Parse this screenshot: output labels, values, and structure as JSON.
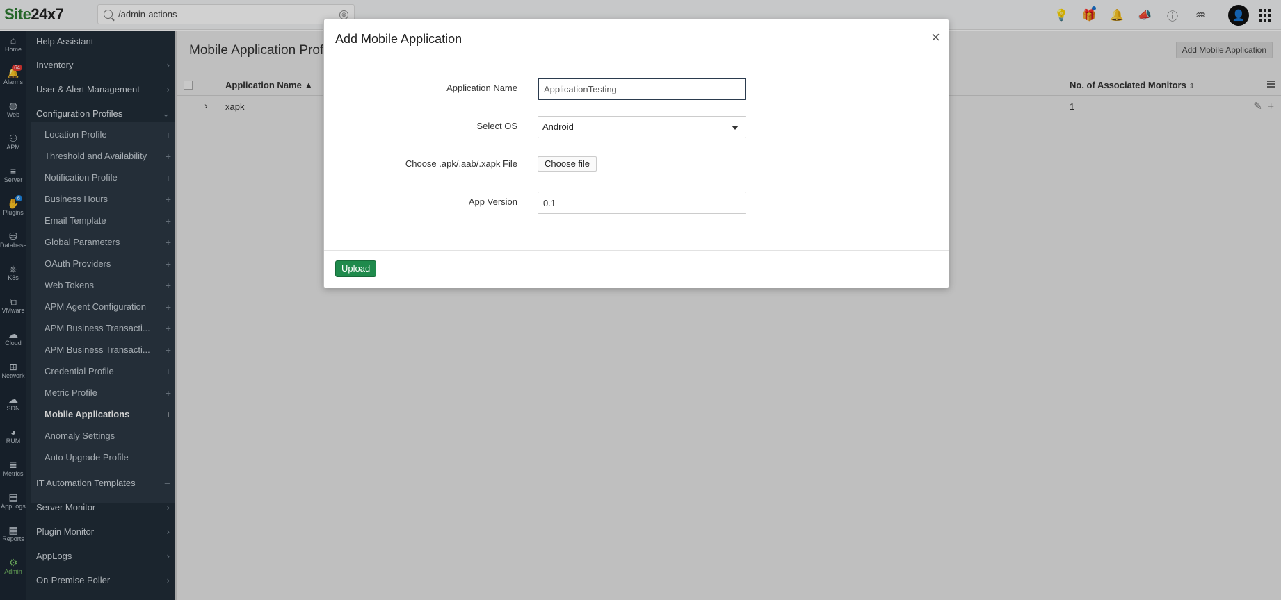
{
  "app": {
    "logo_part1": "Site",
    "logo_part2": "24x7"
  },
  "search": {
    "value": "/admin-actions",
    "clear_glyph": "⊗"
  },
  "topbar_icons": [
    "bulb-icon",
    "gift-icon",
    "bell-icon",
    "megaphone-icon",
    "help-icon",
    "zia-icon"
  ],
  "rail": [
    {
      "label": "Home",
      "icon": "⌂",
      "badge": ""
    },
    {
      "label": "Alarms",
      "icon": "🔔",
      "badge": "64"
    },
    {
      "label": "Web",
      "icon": "◍",
      "badge": ""
    },
    {
      "label": "APM",
      "icon": "⚇",
      "badge": ""
    },
    {
      "label": "Server",
      "icon": "≡",
      "badge": ""
    },
    {
      "label": "Plugins",
      "icon": "✋",
      "badge": "6"
    },
    {
      "label": "Database",
      "icon": "⛁",
      "badge": ""
    },
    {
      "label": "K8s",
      "icon": "⎈",
      "badge": ""
    },
    {
      "label": "VMware",
      "icon": "⧉",
      "badge": ""
    },
    {
      "label": "Cloud",
      "icon": "☁",
      "badge": ""
    },
    {
      "label": "Network",
      "icon": "⊞",
      "badge": ""
    },
    {
      "label": "SDN",
      "icon": "☁",
      "badge": ""
    },
    {
      "label": "RUM",
      "icon": "◕",
      "badge": ""
    },
    {
      "label": "Metrics",
      "icon": "≣",
      "badge": ""
    },
    {
      "label": "AppLogs",
      "icon": "▤",
      "badge": ""
    },
    {
      "label": "Reports",
      "icon": "▦",
      "badge": ""
    },
    {
      "label": "Admin",
      "icon": "⚙",
      "badge": ""
    }
  ],
  "menu": {
    "top_items": [
      "Help Assistant",
      "Inventory",
      "User & Alert Management",
      "Configuration Profiles"
    ],
    "sub_items": [
      "Location Profile",
      "Threshold and Availability",
      "Notification Profile",
      "Business Hours",
      "Email Template",
      "Global Parameters",
      "OAuth Providers",
      "Web Tokens",
      "APM Agent Configuration",
      "APM Business Transacti...",
      "APM Business Transacti...",
      "Credential Profile",
      "Metric Profile",
      "Mobile Applications",
      "Anomaly Settings",
      "Auto Upgrade Profile"
    ],
    "bottom_items": [
      "IT Automation Templates",
      "Server Monitor",
      "Plugin Monitor",
      "AppLogs",
      "On-Premise Poller"
    ]
  },
  "main": {
    "page_title": "Mobile Application Profi",
    "add_button": "Add Mobile Application",
    "columns": {
      "name": "Application Name",
      "monitors": "No. of Associated Monitors"
    },
    "rows": [
      {
        "name": "xapk",
        "monitors": "1"
      }
    ]
  },
  "modal": {
    "title": "Add Mobile Application",
    "close_glyph": "×",
    "fields": {
      "app_name_label": "Application Name",
      "app_name_value": "ApplicationTesting",
      "os_label": "Select OS",
      "os_value": "Android",
      "file_label": "Choose .apk/.aab/.xapk File",
      "file_button": "Choose file",
      "version_label": "App Version",
      "version_value": "0.1"
    },
    "upload_button": "Upload"
  }
}
